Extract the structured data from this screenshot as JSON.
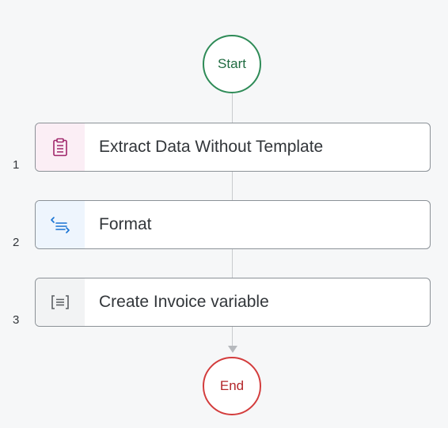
{
  "flow": {
    "start_label": "Start",
    "end_label": "End",
    "steps": [
      {
        "number": "1",
        "label": "Extract Data Without Template",
        "icon": "clipboard-icon",
        "icon_color": "#a0266b",
        "icon_bg": "#fbeef5"
      },
      {
        "number": "2",
        "label": "Format",
        "icon": "format-code-icon",
        "icon_color": "#1873d4",
        "icon_bg": "#eef5fd"
      },
      {
        "number": "3",
        "label": "Create Invoice variable",
        "icon": "variable-icon",
        "icon_color": "#5b5f63",
        "icon_bg": "#f2f3f4"
      }
    ]
  }
}
